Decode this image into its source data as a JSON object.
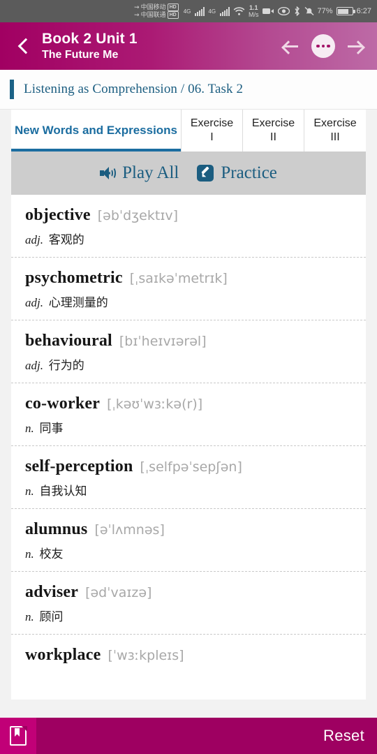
{
  "statusbar": {
    "carrier1": "中国移动",
    "carrier2": "中国联通",
    "hd1": "HD",
    "hd2": "HD",
    "net1": "4G",
    "net2": "4G",
    "speed_value": "1.1",
    "speed_unit": "M/s",
    "battery_percent": "77%",
    "clock": "6:27",
    "icons": [
      "video-camera-icon",
      "eye-icon",
      "bluetooth-icon",
      "bell-muted-icon",
      "battery-icon"
    ]
  },
  "header": {
    "back_icon": "chevron-left-icon",
    "title": "Book 2 Unit 1",
    "subtitle": "The Future Me",
    "prev_icon": "arrow-left-icon",
    "menu_icon": "more-dots-icon",
    "next_icon": "arrow-right-icon"
  },
  "breadcrumb": {
    "text": "Listening as Comprehension / 06. Task 2"
  },
  "tabs": [
    {
      "label": "New Words and Expressions",
      "active": true
    },
    {
      "label": "Exercise\nI",
      "active": false
    },
    {
      "label": "Exercise\nII",
      "active": false
    },
    {
      "label": "Exercise\nIII",
      "active": false
    }
  ],
  "tab_labels": {
    "new_words": "New Words and Expressions",
    "ex1_top": "Exercise",
    "ex1_bottom": "I",
    "ex2_top": "Exercise",
    "ex2_bottom": "II",
    "ex3_top": "Exercise",
    "ex3_bottom": "III"
  },
  "toolbar": {
    "play_all_label": "Play All",
    "play_all_icon": "speaker-icon",
    "practice_label": "Practice",
    "practice_icon": "pencil-icon"
  },
  "words": [
    {
      "term": "objective",
      "ipa": "[əbˈdʒektɪv]",
      "pos": "adj.",
      "meaning": "客观的"
    },
    {
      "term": "psychometric",
      "ipa": "[ˌsaɪkəˈmetrɪk]",
      "pos": "adj.",
      "meaning": "心理测量的"
    },
    {
      "term": "behavioural",
      "ipa": "[bɪˈheɪvɪərəl]",
      "pos": "adj.",
      "meaning": "行为的"
    },
    {
      "term": "co-worker",
      "ipa": "[ˌkəʊˈwɜːkə(r)]",
      "pos": "n.",
      "meaning": "同事"
    },
    {
      "term": "self-perception",
      "ipa": "[ˌselfpəˈsepʃən]",
      "pos": "n.",
      "meaning": "自我认知"
    },
    {
      "term": "alumnus",
      "ipa": "[əˈlʌmnəs]",
      "pos": "n.",
      "meaning": "校友"
    },
    {
      "term": "adviser",
      "ipa": "[ədˈvaɪzə]",
      "pos": "n.",
      "meaning": "顾问"
    },
    {
      "term": "workplace",
      "ipa": "[ˈwɜːkpleɪs]",
      "pos": "",
      "meaning": ""
    }
  ],
  "bottombar": {
    "doc_icon": "document-bookmark-icon",
    "reset_label": "Reset"
  },
  "colors": {
    "brand_magenta": "#a10062",
    "bottom_magenta": "#9e0061",
    "accent_blue": "#1b5d80",
    "tab_active_blue": "#1b6da0",
    "page_bg": "#f2f2f2"
  }
}
